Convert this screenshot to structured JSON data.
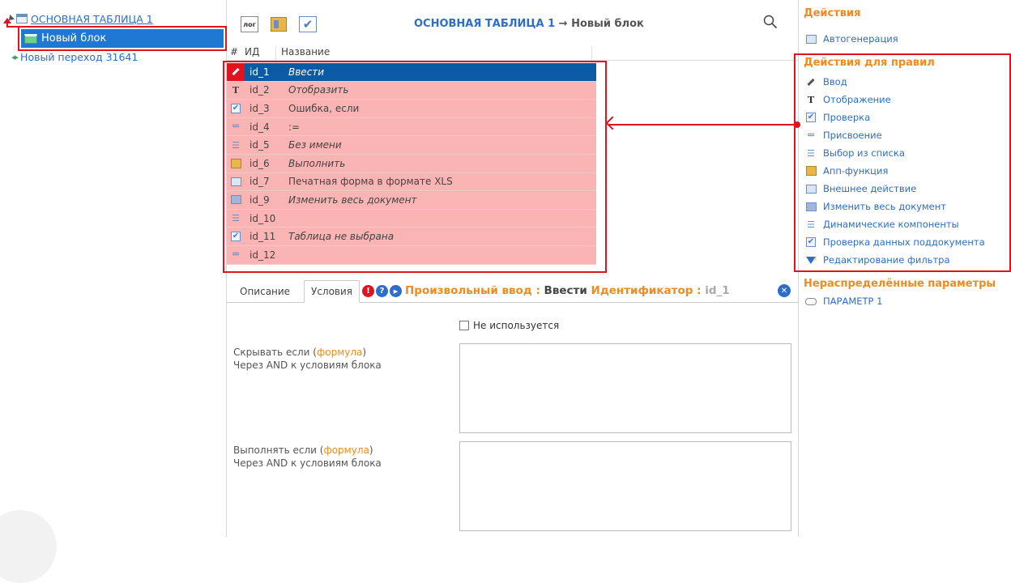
{
  "tree": {
    "root_label": "ОСНОВНАЯ ТАБЛИЦА 1",
    "block_label": "Новый блок",
    "transition_label": "Новый переход 31641"
  },
  "toolbar": {
    "log_label": "лог",
    "title_main": "ОСНОВНАЯ ТАБЛИЦА 1",
    "title_arrow": " → ",
    "title_sub": "Новый блок"
  },
  "grid": {
    "col_hash": "#",
    "col_id": "ИД",
    "col_name": "Название",
    "rows": [
      {
        "icon": "pen-icon",
        "id": "id_1",
        "name": "Ввести"
      },
      {
        "icon": "text-t-icon",
        "id": "id_2",
        "name": "Отобразить"
      },
      {
        "icon": "checkbox-icon",
        "id": "id_3",
        "name": "Ошибка, если"
      },
      {
        "icon": "equals-icon",
        "id": "id_4",
        "name": ":="
      },
      {
        "icon": "list-icon",
        "id": "id_5",
        "name": "Без имени"
      },
      {
        "icon": "app-function-icon",
        "id": "id_6",
        "name": "Выполнить"
      },
      {
        "icon": "external-action-icon",
        "id": "id_7",
        "name": "Печатная форма в формате XLS"
      },
      {
        "icon": "document-icon",
        "id": "id_9",
        "name": "Изменить весь документ"
      },
      {
        "icon": "list-icon",
        "id": "id_10",
        "name": ""
      },
      {
        "icon": "checkbox-icon",
        "id": "id_11",
        "name": "Таблица не выбрана"
      },
      {
        "icon": "equals-icon",
        "id": "id_12",
        "name": ""
      }
    ]
  },
  "details": {
    "tab_description": "Описание",
    "tab_conditions": "Условия",
    "type_label": "Произвольный ввод : ",
    "name_value": "Ввести",
    "identifier_label": " Идентификатор : ",
    "identifier_value": "id_1",
    "unused_label": "Не используется",
    "hide_if_prefix": "Скрывать если (",
    "hide_if_link": "формула",
    "hide_if_suffix": ")",
    "hide_if_note": "Через AND к условиям блока",
    "exec_if_prefix": "Выполнять если (",
    "exec_if_link": "формула",
    "exec_if_suffix": ")",
    "exec_if_note": "Через AND к условиям блока"
  },
  "right": {
    "actions_header": "Действия",
    "autogen_label": "Автогенерация",
    "rules_header": "Действия для правил",
    "rule_actions": [
      {
        "icon": "pen-icon",
        "label": "Ввод"
      },
      {
        "icon": "text-t-icon",
        "label": "Отображение"
      },
      {
        "icon": "checkbox-icon",
        "label": "Проверка"
      },
      {
        "icon": "equals-icon",
        "label": "Присвоение"
      },
      {
        "icon": "list-icon",
        "label": "Выбор из списка"
      },
      {
        "icon": "app-function-icon",
        "label": "Апп-функция"
      },
      {
        "icon": "external-action-icon",
        "label": "Внешнее действие"
      },
      {
        "icon": "document-icon",
        "label": "Изменить весь документ"
      },
      {
        "icon": "list-icon",
        "label": "Динамические компоненты"
      },
      {
        "icon": "checkbox-icon",
        "label": "Проверка данных поддокумента"
      },
      {
        "icon": "filter-icon",
        "label": "Редактирование фильтра"
      }
    ],
    "params_header": "Нераспределённые параметры",
    "param_label": "ПАРАМЕТР 1"
  },
  "colors": {
    "accent_blue": "#2c6ec9",
    "orange": "#f18b1e",
    "highlight_red": "#e0141e",
    "row_pink": "#fbb4b4",
    "selected_row": "#0b5aa5"
  }
}
